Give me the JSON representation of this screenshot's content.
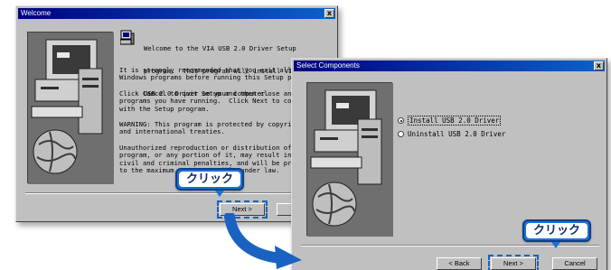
{
  "welcome_dialog": {
    "title": "Welcome",
    "close_label": "x",
    "lines": [
      "Welcome to the VIA USB 2.0 Driver Setup",
      "program.  This program will install VIA",
      "USB 2.0 Driver on your computer."
    ],
    "paragraphs": [
      "It is strongly recommended that you exit all\nWindows programs before running this Setup p",
      "Click Cancel to quit Setup and then close an\nprograms you have running.  Click Next to co\nwith the Setup program.",
      "WARNING: This program is protected by copyri\nand international treaties.",
      "Unauthorized reproduction or distribution of\nprogram, or any portion of it, may result in\ncivil and criminal penalties, and will be pro\nto the maximum extent possible under law."
    ],
    "next_label": "Next >",
    "cancel_label": "Ca"
  },
  "select_dialog": {
    "title": "Select Components",
    "close_label": "x",
    "options": [
      {
        "label": "Install USB 2.0 Driver",
        "selected": true
      },
      {
        "label": "Uninstall USB 2.0 Driver",
        "selected": false
      }
    ],
    "back_label": "< Back",
    "next_label": "Next >",
    "cancel_label": "Cancel"
  },
  "callouts": {
    "first": "クリック",
    "second": "クリック"
  },
  "colors": {
    "callout_fill": "#1d6fd6",
    "arrow": "#1a62c2",
    "titlebar_start": "#000080",
    "titlebar_end": "#0a63c8"
  }
}
